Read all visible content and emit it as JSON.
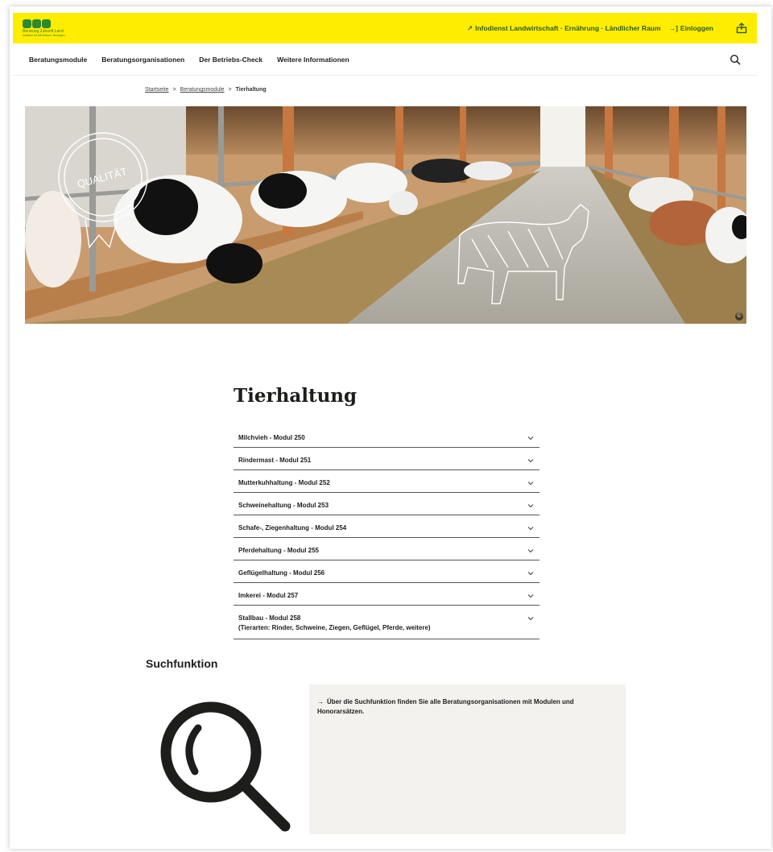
{
  "header": {
    "logo_text": "Beratung.Zukunft.Land",
    "logo_sub": "Initiative für Mit Wissen. Bewegen",
    "infodienst_label": "Infodienst Landwirtschaft · Ernährung · Ländlicher Raum",
    "login_label": "Einloggen",
    "brand_color": "#ffed00"
  },
  "nav": {
    "items": [
      "Beratungsmodule",
      "Beratungsorganisationen",
      "Der Betriebs-Check",
      "Weitere Informationen"
    ]
  },
  "breadcrumb": {
    "home": "Startseite",
    "parent": "Beratungsmodule",
    "current": "Tierhaltung",
    "separator": ">"
  },
  "hero": {
    "badge_text": "QUALITÄT",
    "copyright_symbol": "©"
  },
  "page": {
    "title": "Tierhaltung"
  },
  "modules": [
    {
      "label": "Milchvieh - Modul 250"
    },
    {
      "label": "Rindermast - Modul 251"
    },
    {
      "label": "Mutterkuhhaltung - Modul 252"
    },
    {
      "label": "Schweinehaltung - Modul 253"
    },
    {
      "label": "Schafe-, Ziegenhaltung - Modul 254"
    },
    {
      "label": "Pferdehaltung - Modul 255"
    },
    {
      "label": "Geflügelhaltung - Modul 256"
    },
    {
      "label": "Imkerei - Modul 257"
    },
    {
      "label": "Stallbau - Modul 258",
      "sub": "(Tierarten: Rinder, Schweine, Ziegen, Geflügel, Pferde, weitere)"
    }
  ],
  "search_section": {
    "title": "Suchfunktion",
    "link_text": "Über die Suchfunktion finden Sie alle Beratungsorganisationen mit Modulen und Honorarsätzen."
  }
}
